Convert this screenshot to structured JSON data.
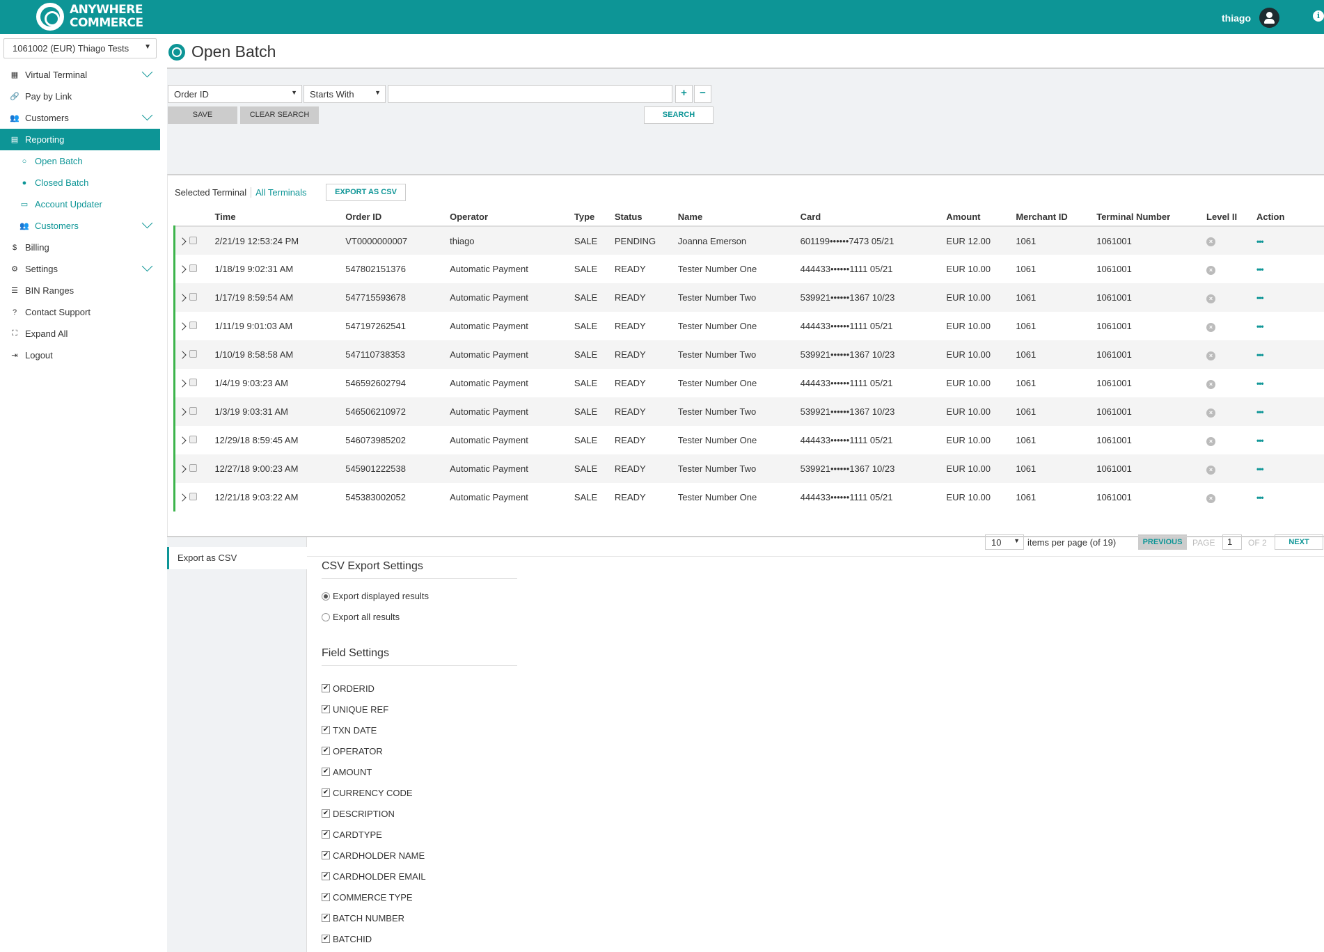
{
  "header": {
    "logo_line1": "ANYWHERE",
    "logo_line2": "COMMERCE",
    "username": "thiago",
    "info_glyph": "i",
    "brand_color": "#0d9596"
  },
  "sidebar": {
    "terminal_select": "1061002 (EUR) Thiago Tests",
    "items": [
      {
        "label": "Virtual Terminal",
        "icon": "calculator-icon",
        "glyph": "▦",
        "expandable": true
      },
      {
        "label": "Pay by Link",
        "icon": "link-icon",
        "glyph": "🔗",
        "expandable": false
      },
      {
        "label": "Customers",
        "icon": "users-icon",
        "glyph": "👥",
        "expandable": true
      },
      {
        "label": "Reporting",
        "icon": "file-icon",
        "glyph": "▤",
        "expandable": false,
        "active": true
      },
      {
        "label": "Open Batch",
        "icon": "circle-icon",
        "glyph": "○",
        "sub": true
      },
      {
        "label": "Closed Batch",
        "icon": "filled-circle-icon",
        "glyph": "●",
        "sub": true
      },
      {
        "label": "Account Updater",
        "icon": "card-icon",
        "glyph": "▭",
        "sub": true
      },
      {
        "label": "Customers",
        "icon": "users-icon",
        "glyph": "👥",
        "sub": true,
        "expandable": true
      },
      {
        "label": "Billing",
        "icon": "dollar-icon",
        "glyph": "$",
        "expandable": false
      },
      {
        "label": "Settings",
        "icon": "gears-icon",
        "glyph": "⚙",
        "expandable": true
      },
      {
        "label": "BIN Ranges",
        "icon": "list-icon",
        "glyph": "☰",
        "expandable": false
      },
      {
        "label": "Contact Support",
        "icon": "question-icon",
        "glyph": "?",
        "expandable": false
      },
      {
        "label": "Expand All",
        "icon": "expand-icon",
        "glyph": "⛶",
        "expandable": false
      },
      {
        "label": "Logout",
        "icon": "logout-icon",
        "glyph": "⇥",
        "expandable": false
      }
    ]
  },
  "page": {
    "title": "Open Batch"
  },
  "search": {
    "field": "Order ID",
    "operator": "Starts With",
    "value": "",
    "plus": "+",
    "minus": "−",
    "save": "SAVE",
    "clear": "CLEAR SEARCH",
    "search": "SEARCH"
  },
  "results": {
    "selected_terminal": "Selected Terminal",
    "all_terminals": "All Terminals",
    "export_btn": "EXPORT AS CSV",
    "columns": [
      "Time",
      "Order ID",
      "Operator",
      "Type",
      "Status",
      "Name",
      "Card",
      "Amount",
      "Merchant ID",
      "Terminal Number",
      "Level II",
      "Action"
    ],
    "rows": [
      {
        "time": "2/21/19 12:53:24 PM",
        "order_id": "VT0000000007",
        "operator": "thiago",
        "type": "SALE",
        "status": "PENDING",
        "name": "Joanna Emerson",
        "card": "601199••••••7473 05/21",
        "amount": "EUR 12.00",
        "merchant_id": "1061",
        "terminal": "1061001"
      },
      {
        "time": "1/18/19 9:02:31 AM",
        "order_id": "547802151376",
        "operator": "Automatic Payment",
        "type": "SALE",
        "status": "READY",
        "name": "Tester Number One",
        "card": "444433••••••1111 05/21",
        "amount": "EUR 10.00",
        "merchant_id": "1061",
        "terminal": "1061001"
      },
      {
        "time": "1/17/19 8:59:54 AM",
        "order_id": "547715593678",
        "operator": "Automatic Payment",
        "type": "SALE",
        "status": "READY",
        "name": "Tester Number Two",
        "card": "539921••••••1367 10/23",
        "amount": "EUR 10.00",
        "merchant_id": "1061",
        "terminal": "1061001"
      },
      {
        "time": "1/11/19 9:01:03 AM",
        "order_id": "547197262541",
        "operator": "Automatic Payment",
        "type": "SALE",
        "status": "READY",
        "name": "Tester Number One",
        "card": "444433••••••1111 05/21",
        "amount": "EUR 10.00",
        "merchant_id": "1061",
        "terminal": "1061001"
      },
      {
        "time": "1/10/19 8:58:58 AM",
        "order_id": "547110738353",
        "operator": "Automatic Payment",
        "type": "SALE",
        "status": "READY",
        "name": "Tester Number Two",
        "card": "539921••••••1367 10/23",
        "amount": "EUR 10.00",
        "merchant_id": "1061",
        "terminal": "1061001"
      },
      {
        "time": "1/4/19 9:03:23 AM",
        "order_id": "546592602794",
        "operator": "Automatic Payment",
        "type": "SALE",
        "status": "READY",
        "name": "Tester Number One",
        "card": "444433••••••1111 05/21",
        "amount": "EUR 10.00",
        "merchant_id": "1061",
        "terminal": "1061001"
      },
      {
        "time": "1/3/19 9:03:31 AM",
        "order_id": "546506210972",
        "operator": "Automatic Payment",
        "type": "SALE",
        "status": "READY",
        "name": "Tester Number Two",
        "card": "539921••••••1367 10/23",
        "amount": "EUR 10.00",
        "merchant_id": "1061",
        "terminal": "1061001"
      },
      {
        "time": "12/29/18 8:59:45 AM",
        "order_id": "546073985202",
        "operator": "Automatic Payment",
        "type": "SALE",
        "status": "READY",
        "name": "Tester Number One",
        "card": "444433••••••1111 05/21",
        "amount": "EUR 10.00",
        "merchant_id": "1061",
        "terminal": "1061001"
      },
      {
        "time": "12/27/18 9:00:23 AM",
        "order_id": "545901222538",
        "operator": "Automatic Payment",
        "type": "SALE",
        "status": "READY",
        "name": "Tester Number Two",
        "card": "539921••••••1367 10/23",
        "amount": "EUR 10.00",
        "merchant_id": "1061",
        "terminal": "1061001"
      },
      {
        "time": "12/21/18 9:03:22 AM",
        "order_id": "545383002052",
        "operator": "Automatic Payment",
        "type": "SALE",
        "status": "READY",
        "name": "Tester Number One",
        "card": "444433••••••1111 05/21",
        "amount": "EUR 10.00",
        "merchant_id": "1061",
        "terminal": "1061001"
      }
    ],
    "level_glyph": "×",
    "action_glyph": "•••"
  },
  "pagination": {
    "per_page": "10",
    "per_page_label": "items per page (of 19)",
    "previous": "PREVIOUS",
    "page_label": "PAGE",
    "page": "1",
    "of_label": "OF 2",
    "next": "NEXT"
  },
  "export": {
    "tab_label": "Export as CSV",
    "csv_title": "CSV Export Settings",
    "option_displayed": "Export displayed results",
    "option_all": "Export all results",
    "field_title": "Field Settings",
    "check_glyph": "✔",
    "fields": [
      "ORDERID",
      "UNIQUE REF",
      "TXN DATE",
      "OPERATOR",
      "AMOUNT",
      "CURRENCY CODE",
      "DESCRIPTION",
      "CARDTYPE",
      "CARDHOLDER NAME",
      "CARDHOLDER EMAIL",
      "COMMERCE TYPE",
      "BATCH NUMBER",
      "BATCHID"
    ]
  }
}
